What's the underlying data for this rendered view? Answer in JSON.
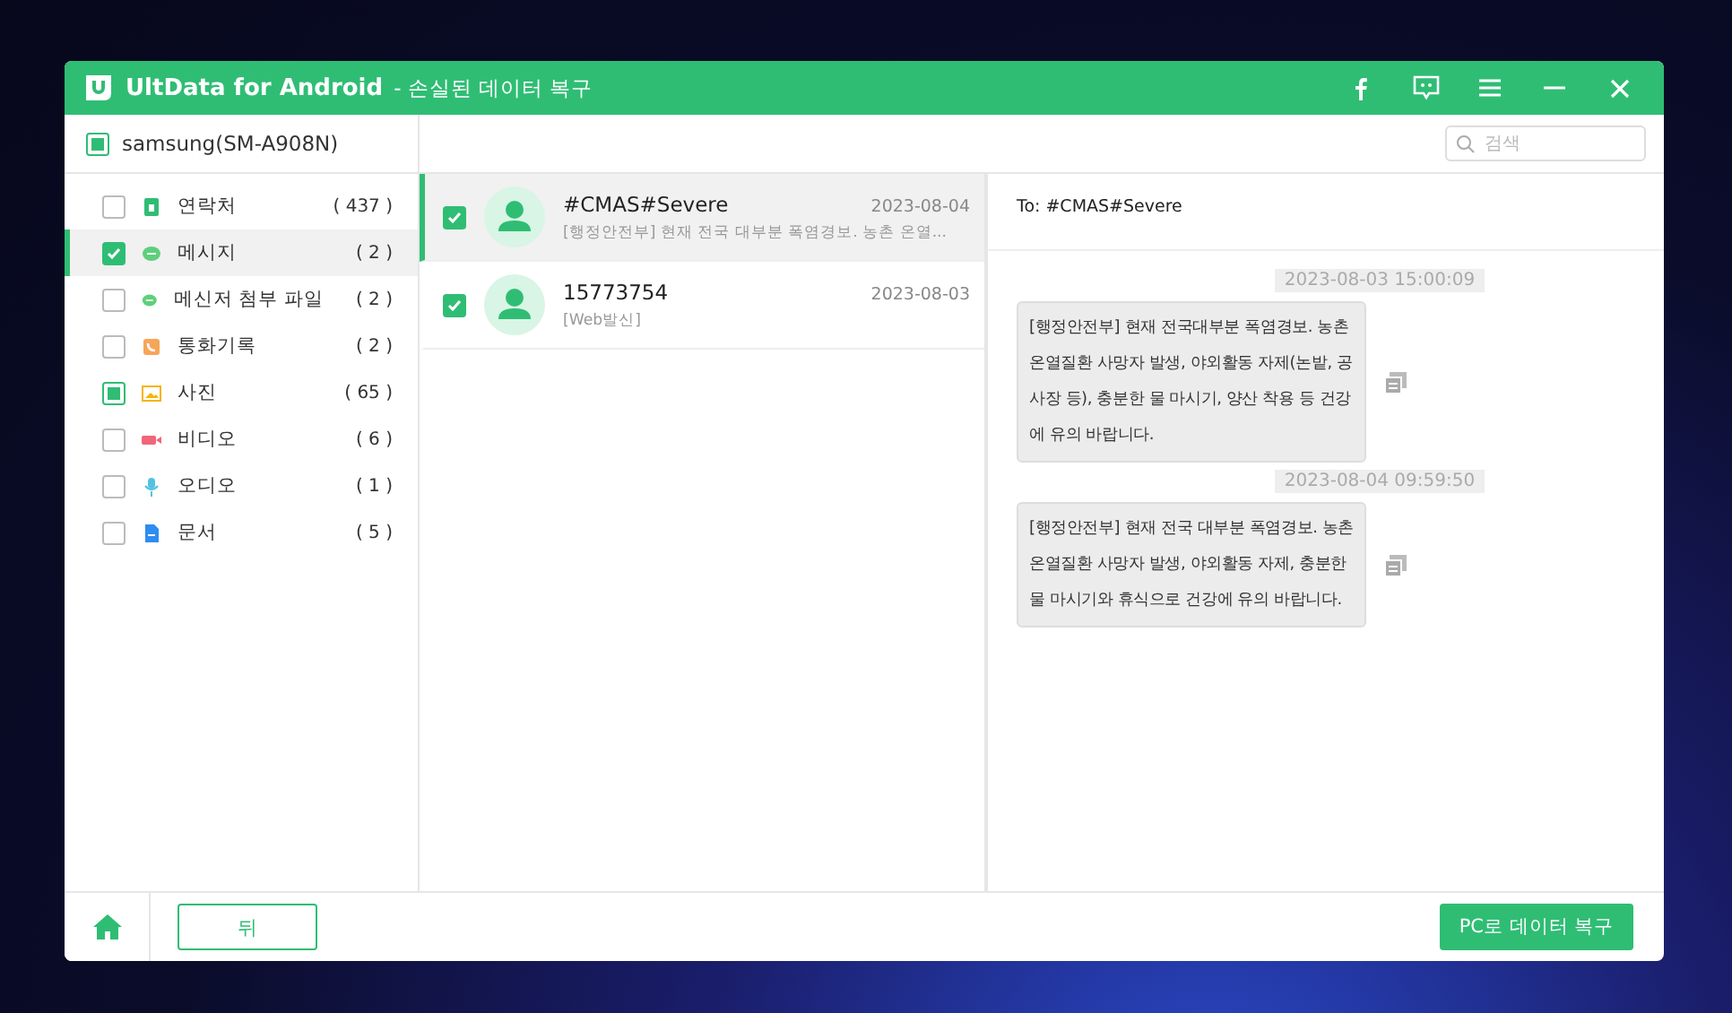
{
  "window": {
    "app_name": "UltData for Android",
    "subtitle": "- 손실된 데이터 복구"
  },
  "device": {
    "name": "samsung(SM-A908N)",
    "checked": false,
    "partial": true
  },
  "search": {
    "placeholder": "검색"
  },
  "categories": [
    {
      "kind": "contacts",
      "label": "연락처",
      "count": "( 437 )",
      "checked": false,
      "partial": false,
      "selected": false
    },
    {
      "kind": "message",
      "label": "메시지",
      "count": "( 2 )",
      "checked": true,
      "partial": false,
      "selected": true
    },
    {
      "kind": "attachment",
      "label": "메신저 첨부 파일",
      "count": "( 2 )",
      "checked": false,
      "partial": false,
      "selected": false
    },
    {
      "kind": "calls",
      "label": "통화기록",
      "count": "( 2 )",
      "checked": false,
      "partial": false,
      "selected": false
    },
    {
      "kind": "photo",
      "label": "사진",
      "count": "( 65 )",
      "checked": false,
      "partial": true,
      "selected": false
    },
    {
      "kind": "video",
      "label": "비디오",
      "count": "( 6 )",
      "checked": false,
      "partial": false,
      "selected": false
    },
    {
      "kind": "audio",
      "label": "오디오",
      "count": "( 1 )",
      "checked": false,
      "partial": false,
      "selected": false
    },
    {
      "kind": "document",
      "label": "문서",
      "count": "( 5 )",
      "checked": false,
      "partial": false,
      "selected": false
    }
  ],
  "threads": [
    {
      "name": "#CMAS#Severe",
      "date": "2023-08-04",
      "preview": "[행정안전부] 현재 전국 대부분 폭염경보. 농촌 온열...",
      "checked": true,
      "selected": true
    },
    {
      "name": "15773754",
      "date": "2023-08-03",
      "preview": "[Web발신]",
      "checked": true,
      "selected": false
    }
  ],
  "conversation": {
    "to": "To: #CMAS#Severe",
    "messages": [
      {
        "time": "2023-08-03 15:00:09",
        "text": "[행정안전부] 현재 전국대부분 폭염경보. 농촌 온열질환 사망자 발생, 야외활동 자제(논밭, 공사장 등), 충분한 물 마시기, 양산 착용 등 건강에 유의 바랍니다."
      },
      {
        "time": "2023-08-04 09:59:50",
        "text": "[행정안전부] 현재 전국 대부분 폭염경보. 농촌 온열질환 사망자 발생, 야외활동 자제, 충분한 물 마시기와 휴식으로 건강에 유의 바랍니다."
      }
    ]
  },
  "footer": {
    "back": "뒤",
    "recover": "PC로 데이터 복구"
  }
}
